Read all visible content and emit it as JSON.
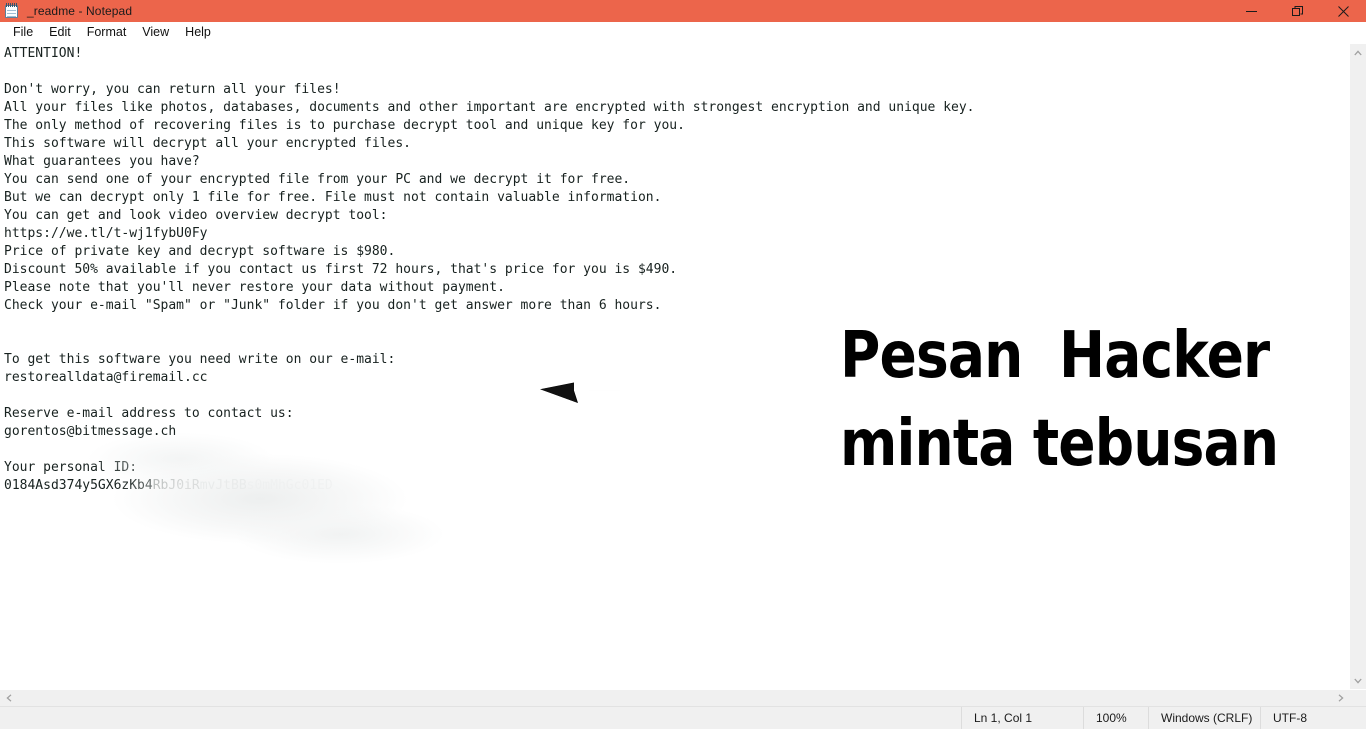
{
  "window": {
    "title": "_readme - Notepad",
    "icon": "notepad-icon",
    "titlebar_color": "#ec654b",
    "controls": {
      "minimize": "Minimize",
      "restore": "Restore Down",
      "close": "Close"
    }
  },
  "menubar": {
    "items": [
      {
        "label": "File"
      },
      {
        "label": "Edit"
      },
      {
        "label": "Format"
      },
      {
        "label": "View"
      },
      {
        "label": "Help"
      }
    ]
  },
  "document": {
    "body": "ATTENTION!\n\nDon't worry, you can return all your files!\nAll your files like photos, databases, documents and other important are encrypted with strongest encryption and unique key.\nThe only method of recovering files is to purchase decrypt tool and unique key for you.\nThis software will decrypt all your encrypted files.\nWhat guarantees you have?\nYou can send one of your encrypted file from your PC and we decrypt it for free.\nBut we can decrypt only 1 file for free. File must not contain valuable information.\nYou can get and look video overview decrypt tool:\nhttps://we.tl/t-wj1fybU0Fy\nPrice of private key and decrypt software is $980.\nDiscount 50% available if you contact us first 72 hours, that's price for you is $490.\nPlease note that you'll never restore your data without payment.\nCheck your e-mail \"Spam\" or \"Junk\" folder if you don't get answer more than 6 hours.\n\n\nTo get this software you need write on our e-mail:\nrestorealldata@firemail.cc\n\nReserve e-mail address to contact us:\ngorentos@bitmessage.ch\n\nYour personal ID:",
    "personal_id_visible": "0184Asd374y5GX6zKb4",
    "personal_id_fade1": "RbJ0iR",
    "personal_id_fade2": "mvJtBB",
    "personal_id_fade3": "s0mMhGc01ED"
  },
  "scrollbars": {
    "vertical_up": "scroll-up",
    "vertical_down": "scroll-down",
    "horizontal_left": "scroll-left",
    "horizontal_right": "scroll-right"
  },
  "statusbar": {
    "position": "Ln 1, Col 1",
    "zoom": "100%",
    "line_ending": "Windows (CRLF)",
    "encoding": "UTF-8"
  },
  "annotation": {
    "arrow": "left-arrow-annotation",
    "caption_line1": "Pesan  Hacker",
    "caption_line2": "minta tebusan",
    "color": "#000000"
  }
}
